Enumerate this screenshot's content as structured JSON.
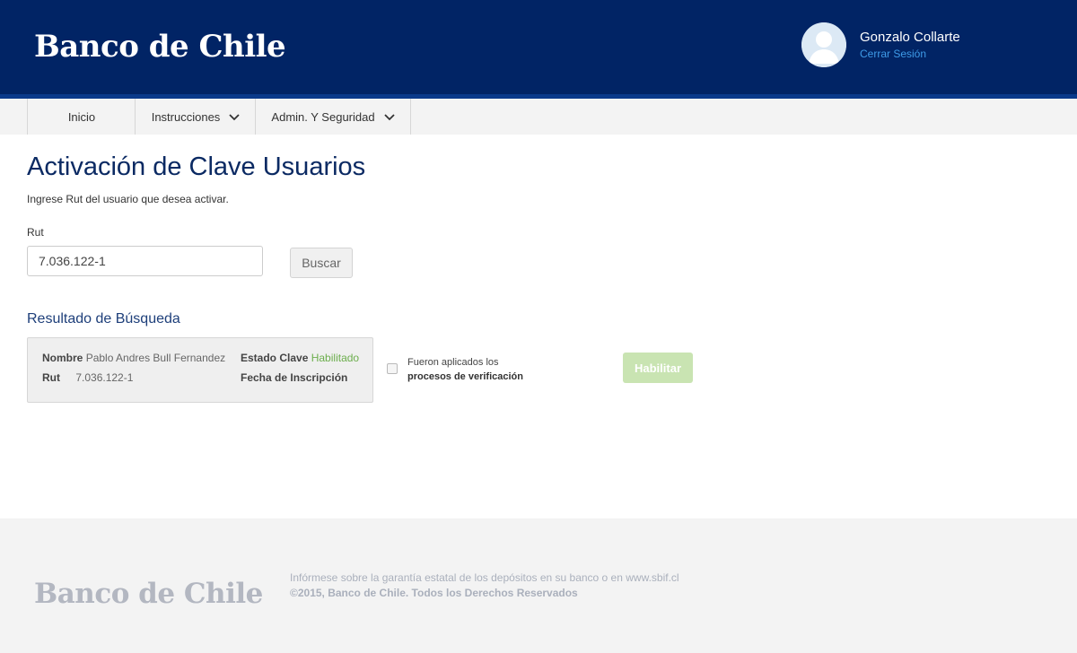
{
  "header": {
    "logo_text": "Banco de Chile",
    "user_name": "Gonzalo Collarte",
    "logout_label": "Cerrar Sesión"
  },
  "nav": {
    "items": [
      {
        "label": "Inicio",
        "icon": null
      },
      {
        "label": "Instrucciones",
        "icon": "chevron-down-icon"
      },
      {
        "label": "Admin. Y Seguridad",
        "icon": "chevron-down-icon"
      }
    ]
  },
  "main": {
    "title": "Activación de Clave Usuarios",
    "subtitle": "Ingrese Rut del usuario que desea activar.",
    "rut_label": "Rut",
    "rut_value": "7.036.122-1",
    "search_button": "Buscar",
    "results_title": "Resultado de Búsqueda",
    "result": {
      "nombre_label": "Nombre",
      "nombre_value": "Pablo Andres Bull Fernandez",
      "rut_label": "Rut",
      "rut_value": "7.036.122-1",
      "estado_label": "Estado Clave",
      "estado_value": "Habilitado",
      "fecha_label": "Fecha de Inscripción",
      "fecha_value": ""
    },
    "verification": {
      "line1": "Fueron aplicados los",
      "line2": "procesos de verificación",
      "checked": false
    },
    "enable_button": "Habilitar"
  },
  "footer": {
    "logo_text": "Banco de Chile",
    "line1": "Infórmese sobre la garantía estatal de los depósitos en su banco o en www.sbif.cl",
    "line2": "©2015, Banco de Chile. Todos los Derechos Reservados"
  },
  "colors": {
    "header_bg": "#012465",
    "title": "#0b2a63",
    "link": "#3e9be8",
    "status_ok": "#6cae4d",
    "enable_button_bg": "#c9e4b2"
  }
}
